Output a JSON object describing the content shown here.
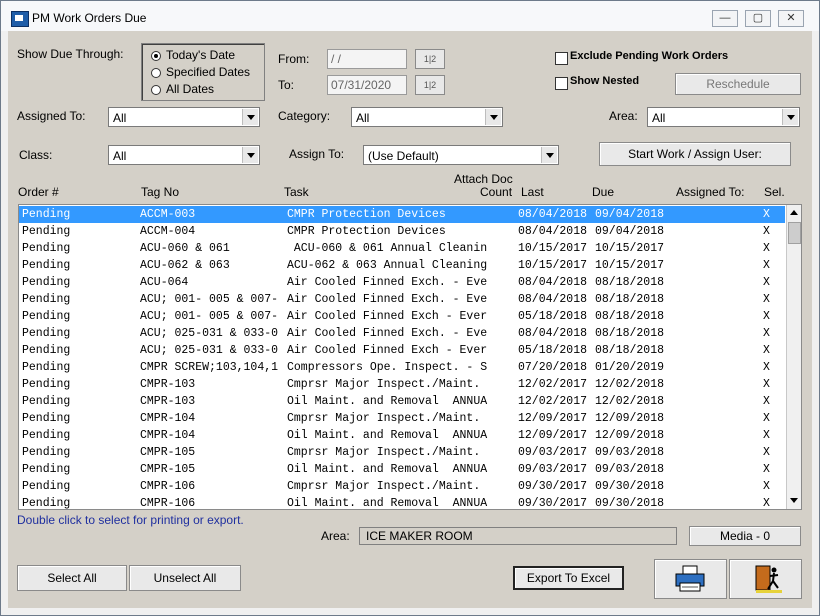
{
  "window": {
    "title": "PM Work Orders Due",
    "controls": [
      "minimize",
      "maximize",
      "close"
    ]
  },
  "filters": {
    "show_due_label": "Show Due Through:",
    "radio_options": [
      "Today's Date",
      "Specified Dates",
      "All Dates"
    ],
    "selected_index": 0,
    "from_label": "From:",
    "from_value": " / /",
    "to_label": "To:",
    "to_value": "07/31/2020",
    "calendar_button": "1|2",
    "exclude_pending_label": "Exclude Pending Work Orders",
    "show_nested_label": "Show Nested",
    "reschedule_label": "Reschedule",
    "assigned_to_label": "Assigned To:",
    "assigned_to_value": "All",
    "category_label": "Category:",
    "category_value": "All",
    "area_label": "Area:",
    "area_value": "All",
    "class_label": "Class:",
    "class_value": "All",
    "assign_to_label": "Assign To:",
    "assign_to_value": "(Use Default)",
    "start_work_label": "Start Work / Assign User:"
  },
  "table": {
    "headers": {
      "order": "Order #",
      "tag": "Tag No",
      "task": "Task",
      "attach_line1": "Attach Doc",
      "attach_line2": "Count",
      "last": "Last",
      "due": "Due",
      "assigned": "Assigned To:",
      "sel": "Sel."
    },
    "rows": [
      {
        "order": "Pending",
        "tag": "ACCM-003",
        "task": "CMPR Protection Devices",
        "last": "08/04/2018",
        "due": "09/04/2018",
        "sel": "X"
      },
      {
        "order": "Pending",
        "tag": "ACCM-004",
        "task": "CMPR Protection Devices",
        "last": "08/04/2018",
        "due": "09/04/2018",
        "sel": "X"
      },
      {
        "order": "Pending",
        "tag": "ACU-060 & 061",
        "task": " ACU-060 & 061 Annual Cleanin",
        "last": "10/15/2017",
        "due": "10/15/2017",
        "sel": "X"
      },
      {
        "order": "Pending",
        "tag": "ACU-062 & 063",
        "task": "ACU-062 & 063 Annual Cleaning",
        "last": "10/15/2017",
        "due": "10/15/2017",
        "sel": "X"
      },
      {
        "order": "Pending",
        "tag": "ACU-064",
        "task": "Air Cooled Finned Exch. - Eve",
        "last": "08/04/2018",
        "due": "08/18/2018",
        "sel": "X"
      },
      {
        "order": "Pending",
        "tag": "ACU; 001- 005 & 007-",
        "task": "Air Cooled Finned Exch. - Eve",
        "last": "08/04/2018",
        "due": "08/18/2018",
        "sel": "X"
      },
      {
        "order": "Pending",
        "tag": "ACU; 001- 005 & 007-",
        "task": "Air Cooled Finned Exch - Ever",
        "last": "05/18/2018",
        "due": "08/18/2018",
        "sel": "X"
      },
      {
        "order": "Pending",
        "tag": "ACU; 025-031 & 033-0",
        "task": "Air Cooled Finned Exch. - Eve",
        "last": "08/04/2018",
        "due": "08/18/2018",
        "sel": "X"
      },
      {
        "order": "Pending",
        "tag": "ACU; 025-031 & 033-0",
        "task": "Air Cooled Finned Exch - Ever",
        "last": "05/18/2018",
        "due": "08/18/2018",
        "sel": "X"
      },
      {
        "order": "Pending",
        "tag": "CMPR SCREW;103,104,1",
        "task": "Compressors Ope. Inspect. - S",
        "last": "07/20/2018",
        "due": "01/20/2019",
        "sel": "X"
      },
      {
        "order": "Pending",
        "tag": "CMPR-103",
        "task": "Cmprsr Major Inspect./Maint.",
        "last": "12/02/2017",
        "due": "12/02/2018",
        "sel": "X"
      },
      {
        "order": "Pending",
        "tag": "CMPR-103",
        "task": "Oil Maint. and Removal  ANNUA",
        "last": "12/02/2017",
        "due": "12/02/2018",
        "sel": "X"
      },
      {
        "order": "Pending",
        "tag": "CMPR-104",
        "task": "Cmprsr Major Inspect./Maint.",
        "last": "12/09/2017",
        "due": "12/09/2018",
        "sel": "X"
      },
      {
        "order": "Pending",
        "tag": "CMPR-104",
        "task": "Oil Maint. and Removal  ANNUA",
        "last": "12/09/2017",
        "due": "12/09/2018",
        "sel": "X"
      },
      {
        "order": "Pending",
        "tag": "CMPR-105",
        "task": "Cmprsr Major Inspect./Maint.",
        "last": "09/03/2017",
        "due": "09/03/2018",
        "sel": "X"
      },
      {
        "order": "Pending",
        "tag": "CMPR-105",
        "task": "Oil Maint. and Removal  ANNUA",
        "last": "09/03/2017",
        "due": "09/03/2018",
        "sel": "X"
      },
      {
        "order": "Pending",
        "tag": "CMPR-106",
        "task": "Cmprsr Major Inspect./Maint.",
        "last": "09/30/2017",
        "due": "09/30/2018",
        "sel": "X"
      },
      {
        "order": "Pending",
        "tag": "CMPR-106",
        "task": "Oil Maint. and Removal  ANNUA",
        "last": "09/30/2017",
        "due": "09/30/2018",
        "sel": "X"
      }
    ],
    "selected_row": 0
  },
  "footer": {
    "hint": "Double click to select for printing or export.",
    "area_label": "Area:",
    "area_value": "ICE MAKER ROOM",
    "media_label": "Media - 0",
    "select_all": "Select All",
    "unselect_all": "Unselect All",
    "export_excel": "Export To Excel"
  },
  "colors": {
    "selection": "#3399ff",
    "hint_text": "#1f2f9f",
    "client_bg": "#d4d0c8"
  },
  "icons": [
    "app-icon",
    "calendar-icon",
    "printer-icon",
    "exit-door-icon"
  ]
}
